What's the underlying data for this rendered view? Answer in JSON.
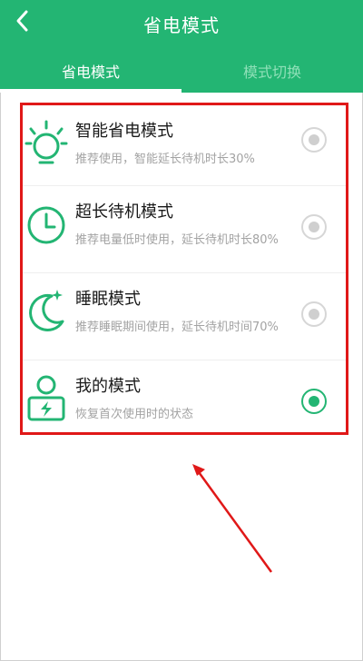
{
  "header": {
    "back_icon": "chevron-left-icon",
    "title": "省电模式",
    "tabs": [
      {
        "label": "省电模式",
        "active": true
      },
      {
        "label": "模式切换",
        "active": false
      }
    ]
  },
  "modes": [
    {
      "title": "智能省电模式",
      "desc": "推荐使用，智能延长待机时长30%",
      "icon": "bulb-icon",
      "selected": false
    },
    {
      "title": "超长待机模式",
      "desc": "推荐电量低时使用，延长待机时长80%",
      "icon": "clock-icon",
      "selected": false
    },
    {
      "title": "睡眠模式",
      "desc": "推荐睡眠期间使用，延长待机时间70%",
      "icon": "moon-icon",
      "selected": false
    },
    {
      "title": "我的模式",
      "desc": "恢复首次使用时的状态",
      "icon": "user-battery-icon",
      "selected": true
    }
  ],
  "colors": {
    "brand": "#23b573",
    "highlight": "#e01818",
    "text": "#1a1a1a",
    "subtext": "#a3a3a3"
  }
}
